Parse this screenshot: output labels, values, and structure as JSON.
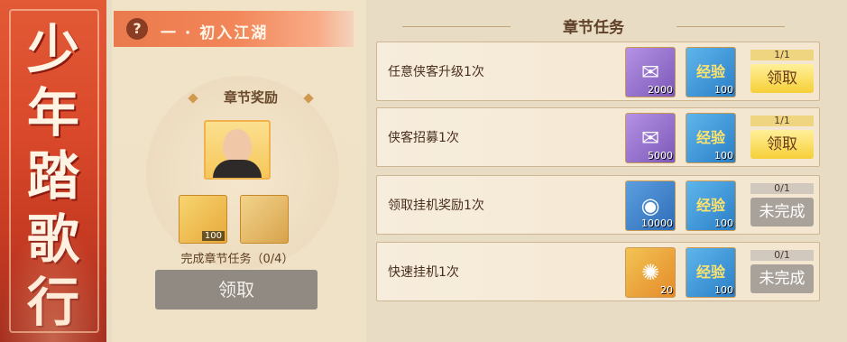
{
  "banner": {
    "title_chars": [
      "少",
      "年",
      "踏",
      "歌",
      "行"
    ]
  },
  "chapter": {
    "help_symbol": "?",
    "title": "一 · 初入江湖",
    "reward_title": "章节奖励",
    "rewards": [
      {
        "icon": "gold-ingot-icon",
        "qty": "100"
      },
      {
        "icon": "money-bag-icon",
        "qty": ""
      }
    ],
    "progress_text": "完成章节任务（0/4）",
    "claim_label": "领取"
  },
  "tasks": {
    "title": "章节任务",
    "rows": [
      {
        "label": "任意侠客升级1次",
        "item1": {
          "icon": "scroll-icon",
          "glyph": "✉",
          "qty": "2000"
        },
        "item2": {
          "glyph": "经验",
          "qty": "100"
        },
        "progress": "1/1",
        "button": "领取"
      },
      {
        "label": "侠客招募1次",
        "item1": {
          "icon": "scroll-icon",
          "glyph": "✉",
          "qty": "5000"
        },
        "item2": {
          "glyph": "经验",
          "qty": "100"
        },
        "progress": "1/1",
        "button": "领取"
      },
      {
        "label": "领取挂机奖励1次",
        "item1": {
          "icon": "coin-icon",
          "glyph": "◉",
          "qty": "10000"
        },
        "item2": {
          "glyph": "经验",
          "qty": "100"
        },
        "progress": "0/1",
        "button": "未完成"
      },
      {
        "label": "快速挂机1次",
        "item1": {
          "icon": "fire-orb-icon",
          "glyph": "✺",
          "qty": "20"
        },
        "item2": {
          "glyph": "经验",
          "qty": "100"
        },
        "progress": "0/1",
        "button": "未完成"
      }
    ]
  }
}
